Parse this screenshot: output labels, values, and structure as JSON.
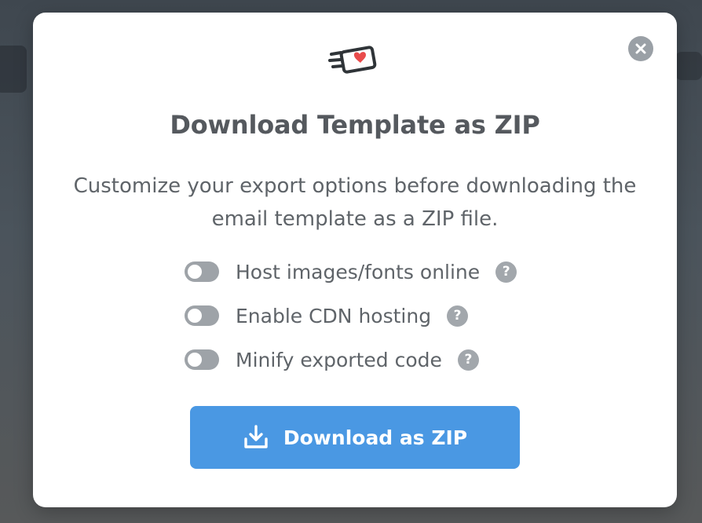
{
  "modal": {
    "title": "Download Template as ZIP",
    "description": "Customize your export options before downloading the email template as a ZIP file.",
    "close_icon": "close-icon",
    "logo_icon": "email-heart-icon"
  },
  "options": [
    {
      "label": "Host images/fonts online",
      "enabled": false,
      "help": "?"
    },
    {
      "label": "Enable CDN hosting",
      "enabled": false,
      "help": "?"
    },
    {
      "label": "Minify exported code",
      "enabled": false,
      "help": "?"
    }
  ],
  "download_button": {
    "label": "Download as ZIP",
    "icon": "download-icon"
  },
  "colors": {
    "accent": "#4a98e3",
    "heart": "#e94b4b",
    "toggle_off": "#9ea3a8",
    "text": "#5f6469"
  }
}
